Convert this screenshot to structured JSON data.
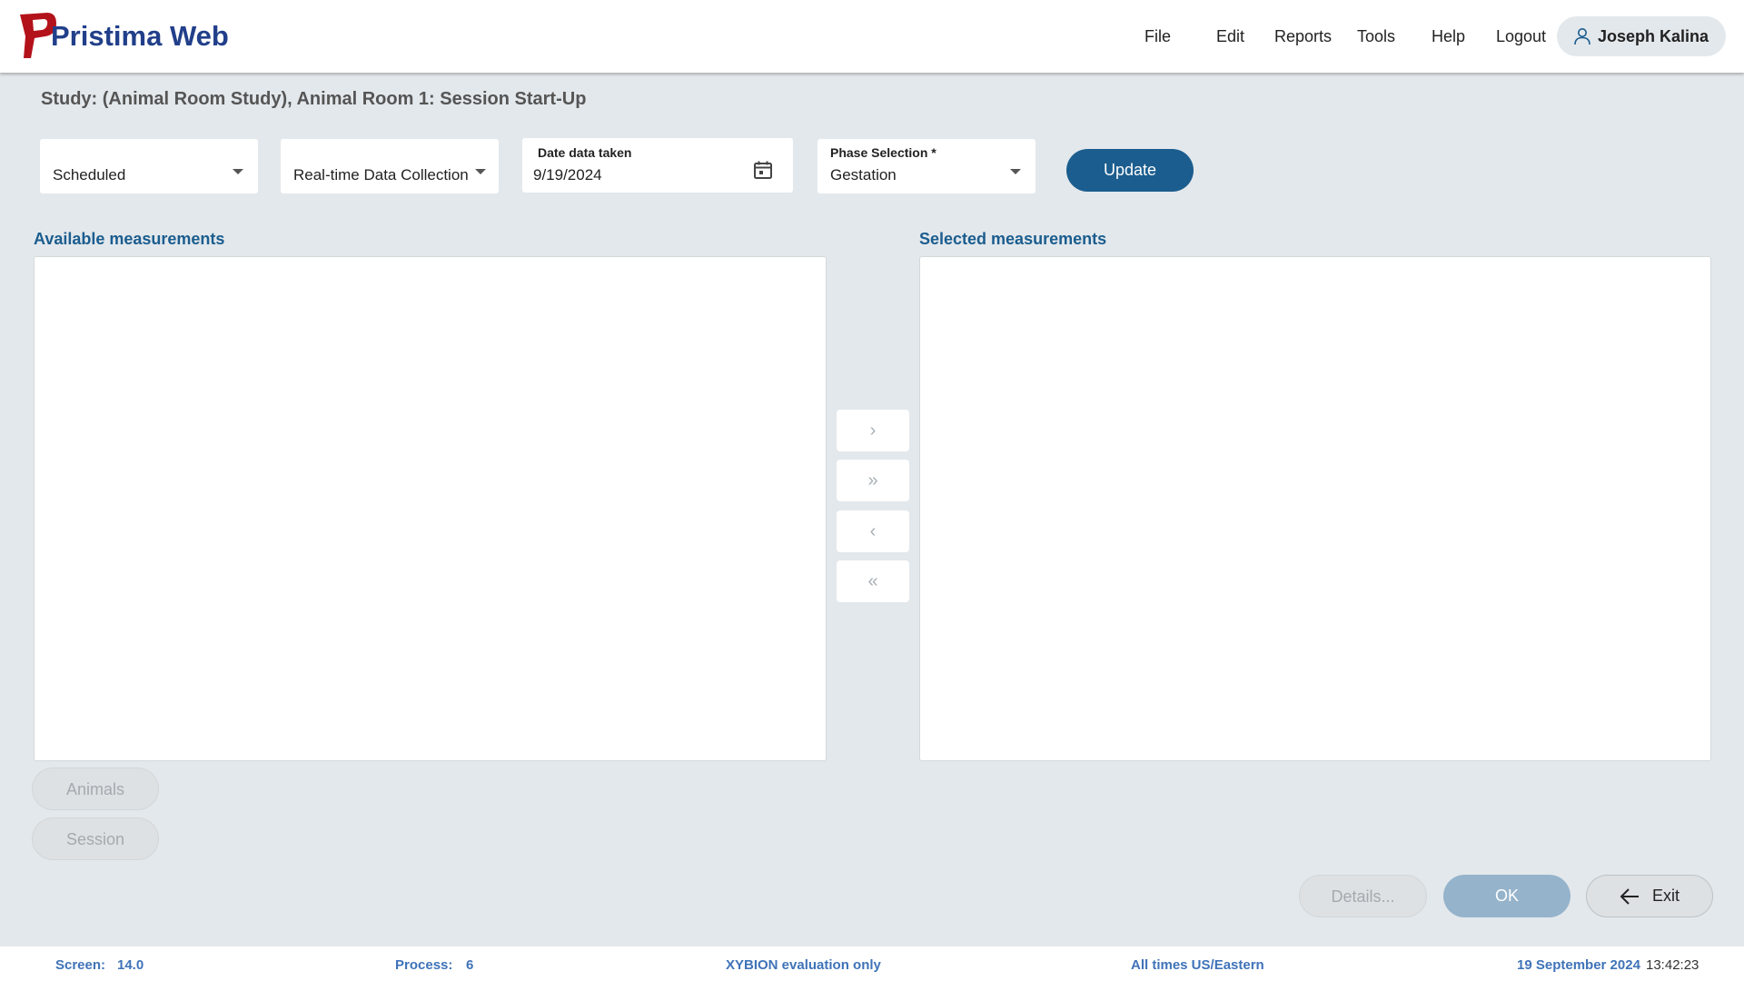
{
  "app": {
    "logo_text": "Pristima Web"
  },
  "nav": {
    "items": [
      "File",
      "Edit",
      "Reports",
      "Tools",
      "Help",
      "Logout"
    ],
    "user_name": "Joseph Kalina"
  },
  "study": {
    "title": "Study: (Animal Room Study), Animal Room 1: Session Start-Up"
  },
  "filters": {
    "schedule_value": "Scheduled",
    "collection_value": "Real-time Data Collection",
    "date_label": "Date data taken",
    "date_value": "9/19/2024",
    "phase_label": "Phase Selection *",
    "phase_value": "Gestation",
    "update_label": "Update"
  },
  "measurements": {
    "available_label": "Available measurements",
    "selected_label": "Selected measurements",
    "move_buttons": [
      "›",
      "»",
      "‹",
      "«"
    ]
  },
  "side_buttons": {
    "animals": "Animals",
    "session": "Session"
  },
  "actions": {
    "details": "Details...",
    "ok": "OK",
    "exit": "Exit"
  },
  "footer": {
    "screen_label": "Screen:",
    "screen_value": "14.0",
    "process_label": "Process:",
    "process_value": "6",
    "evaluation": "XYBION evaluation only",
    "timezone": "All times US/Eastern",
    "date": "19 September 2024",
    "time": "13:42:23"
  },
  "colors": {
    "accent": "#1b5d8e",
    "brand": "#213f8a",
    "logo_red": "#b3121b",
    "background": "#e3e8ec"
  }
}
